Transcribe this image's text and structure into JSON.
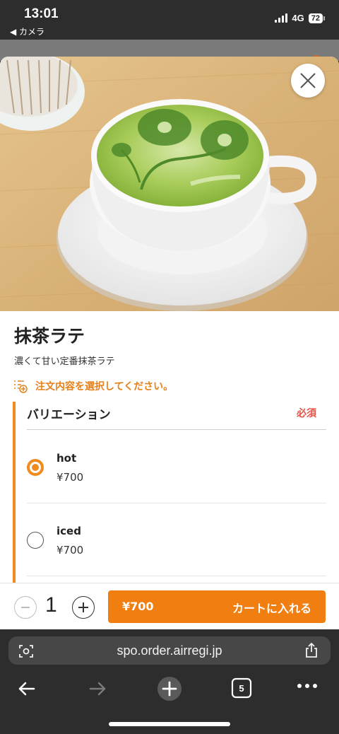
{
  "status_bar": {
    "time": "13:01",
    "back_label": "◀ カメラ",
    "network": "4G",
    "battery": "72"
  },
  "product": {
    "name": "抹茶ラテ",
    "description": "濃くて甘い定番抹茶ラテ",
    "notice": "注文内容を選択してください。"
  },
  "variation": {
    "title": "バリエーション",
    "required_label": "必須",
    "options": [
      {
        "name": "hot",
        "price": "¥700",
        "selected": true
      },
      {
        "name": "iced",
        "price": "¥700",
        "selected": false
      }
    ]
  },
  "order": {
    "quantity": "1",
    "total": "¥700",
    "cart_label": "カートに入れる"
  },
  "browser": {
    "url": "spo.order.airregi.jp",
    "tab_count": "5"
  },
  "colors": {
    "accent": "#f07e10",
    "required": "#e0554a",
    "matcha": "#8fbf3a"
  }
}
